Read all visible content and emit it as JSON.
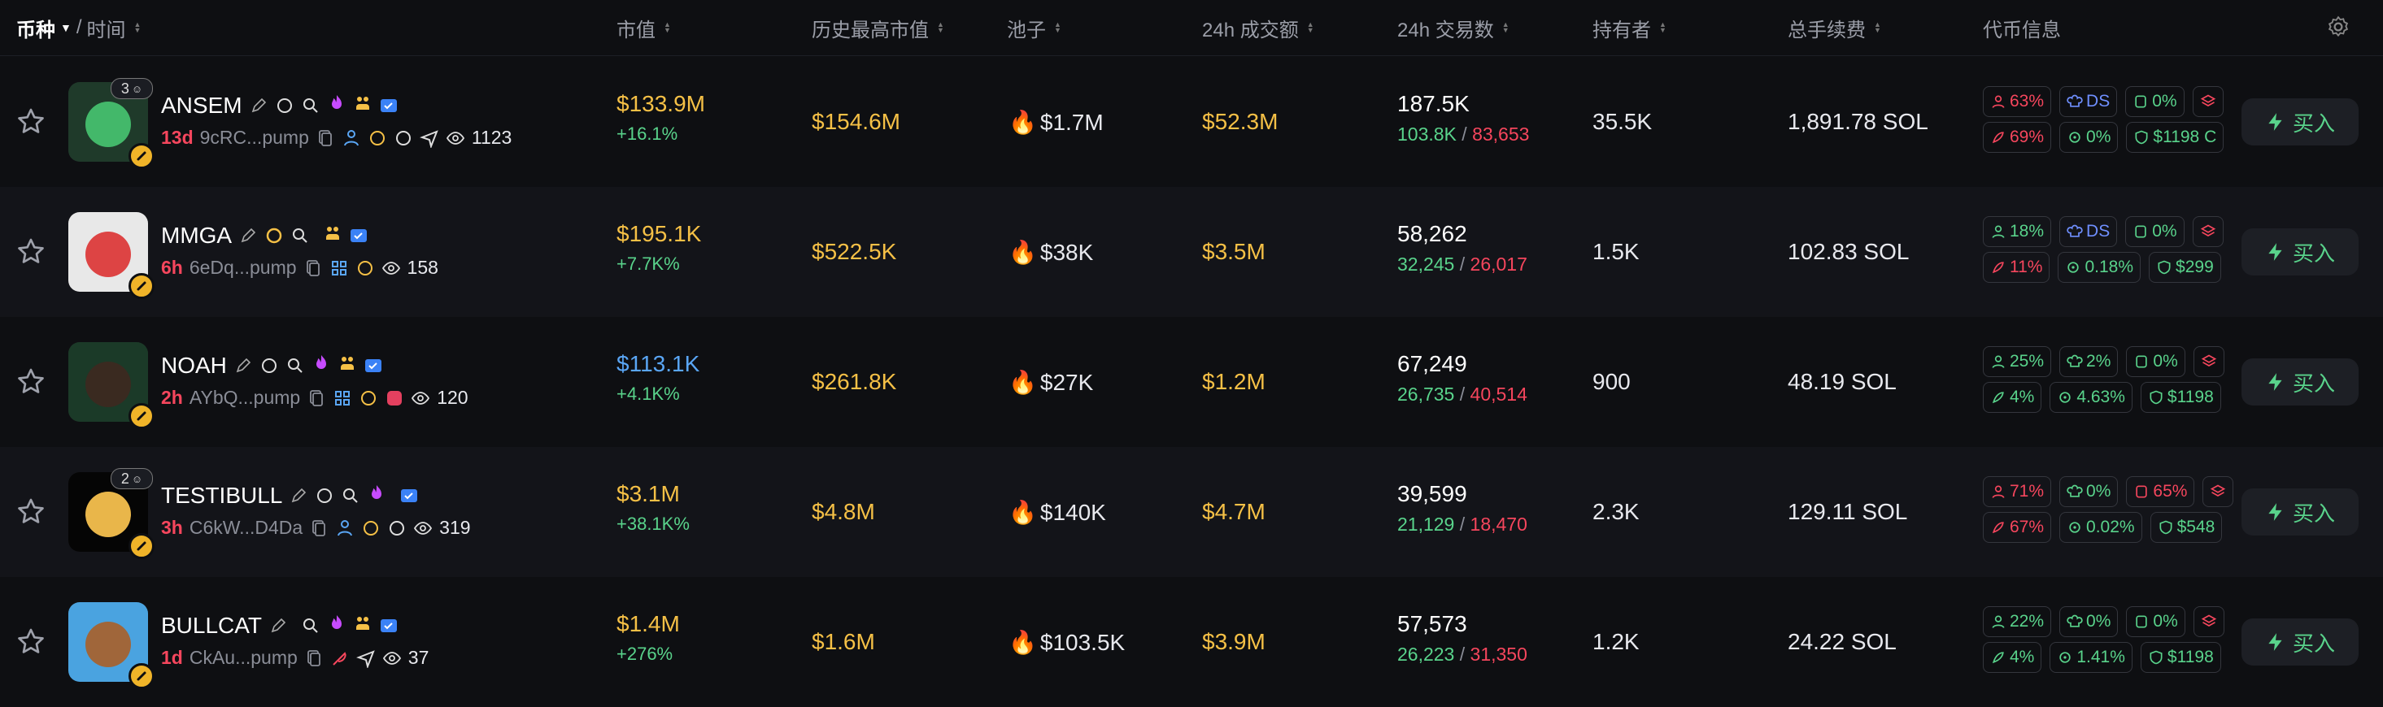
{
  "header": {
    "coin": "币种",
    "slash": "/",
    "time": "时间",
    "market_cap": "市值",
    "ath": "历史最高市值",
    "pool": "池子",
    "volume": "24h 成交额",
    "txns": "24h 交易数",
    "holders": "持有者",
    "fees": "总手续费",
    "info": "代币信息"
  },
  "buy_label": "买入",
  "colors": {
    "green": "#59d38b",
    "red": "#f6465d",
    "yellow": "#f5c046",
    "blue": "#5aa6f5"
  },
  "rows": [
    {
      "name": "ANSEM",
      "holder_badge": "3",
      "age": "13d",
      "address": "9cRC...pump",
      "views": "1123",
      "market_cap": "$133.9M",
      "change": "+16.1%",
      "ath": "$154.6M",
      "pool": "$1.7M",
      "volume": "$52.3M",
      "txns": "187.5K",
      "buys": "103.8K",
      "sells": "83,653",
      "holders": "35.5K",
      "fees": "1,891.78 SOL",
      "info": {
        "c1": "63%",
        "c2": "DS",
        "c3": "0%",
        "c4": "69%",
        "c5": "0%",
        "c6": "$1198 C"
      }
    },
    {
      "name": "MMGA",
      "holder_badge": "",
      "age": "6h",
      "address": "6eDq...pump",
      "views": "158",
      "market_cap": "$195.1K",
      "change": "+7.7K%",
      "ath": "$522.5K",
      "pool": "$38K",
      "volume": "$3.5M",
      "txns": "58,262",
      "buys": "32,245",
      "sells": "26,017",
      "holders": "1.5K",
      "fees": "102.83 SOL",
      "info": {
        "c1": "18%",
        "c2": "DS",
        "c3": "0%",
        "c4": "11%",
        "c5": "0.18%",
        "c6": "$299"
      }
    },
    {
      "name": "NOAH",
      "holder_badge": "",
      "age": "2h",
      "address": "AYbQ...pump",
      "views": "120",
      "market_cap": "$113.1K",
      "change": "+4.1K%",
      "ath": "$261.8K",
      "pool": "$27K",
      "volume": "$1.2M",
      "txns": "67,249",
      "buys": "26,735",
      "sells": "40,514",
      "holders": "900",
      "fees": "48.19 SOL",
      "info": {
        "c1": "25%",
        "c2": "2%",
        "c3": "0%",
        "c4": "4%",
        "c5": "4.63%",
        "c6": "$1198"
      }
    },
    {
      "name": "TESTIBULL",
      "holder_badge": "2",
      "age": "3h",
      "address": "C6kW...D4Da",
      "views": "319",
      "market_cap": "$3.1M",
      "change": "+38.1K%",
      "ath": "$4.8M",
      "pool": "$140K",
      "volume": "$4.7M",
      "txns": "39,599",
      "buys": "21,129",
      "sells": "18,470",
      "holders": "2.3K",
      "fees": "129.11 SOL",
      "info": {
        "c1": "71%",
        "c2": "0%",
        "c3": "65%",
        "c4": "67%",
        "c5": "0.02%",
        "c6": "$548"
      }
    },
    {
      "name": "BULLCAT",
      "holder_badge": "",
      "age": "1d",
      "address": "CkAu...pump",
      "views": "37",
      "market_cap": "$1.4M",
      "change": "+276%",
      "ath": "$1.6M",
      "pool": "$103.5K",
      "volume": "$3.9M",
      "txns": "57,573",
      "buys": "26,223",
      "sells": "31,350",
      "holders": "1.2K",
      "fees": "24.22 SOL",
      "info": {
        "c1": "22%",
        "c2": "0%",
        "c3": "0%",
        "c4": "4%",
        "c5": "1.41%",
        "c6": "$1198"
      }
    }
  ]
}
